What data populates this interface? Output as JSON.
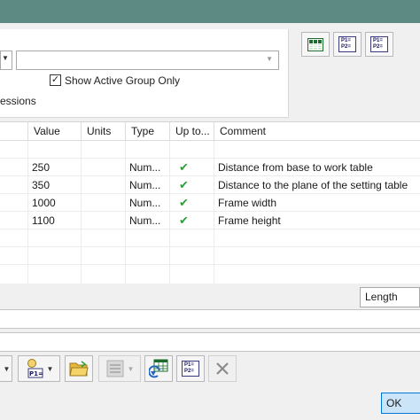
{
  "filter": {
    "show_active_group_only": "Show Active Group Only",
    "checked_mark": "✓",
    "truncated_label": "essions"
  },
  "toolbar": {
    "btn2_p1": "P1=",
    "btn2_p2": "P2=",
    "btn3_p1": "P1=",
    "btn3_p2": "P2="
  },
  "table": {
    "headers": [
      "Value",
      "Units",
      "Type",
      "Up to...",
      "Comment"
    ],
    "rows": [
      {
        "value": "250",
        "units": "",
        "type": "Num...",
        "uptodate": "✔",
        "comment": "Distance from base to work table"
      },
      {
        "value": "350",
        "units": "",
        "type": "Num...",
        "uptodate": "✔",
        "comment": "Distance to the plane of the setting table"
      },
      {
        "value": "1000",
        "units": "",
        "type": "Num...",
        "uptodate": "✔",
        "comment": "Frame  width"
      },
      {
        "value": "1100",
        "units": "",
        "type": "Num...",
        "uptodate": "✔",
        "comment": "Frame height"
      }
    ]
  },
  "unit_type": {
    "selected": "Length"
  },
  "bottom_toolbar": {
    "param_btn_text": "P1=",
    "compare_p1": "P1=",
    "compare_p2": "P2="
  },
  "dialog": {
    "ok_label": "OK"
  },
  "colors": {
    "titlebar": "#5d8b84",
    "check_green": "#2e9e3a",
    "ok_accent": "#0078d7"
  }
}
